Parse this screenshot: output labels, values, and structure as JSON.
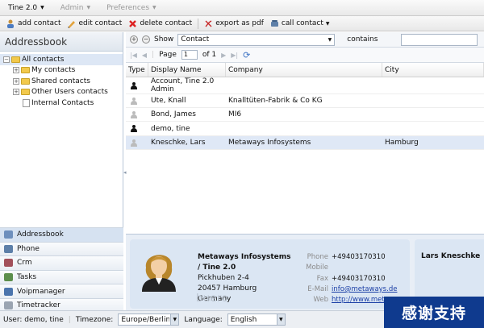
{
  "menubar": {
    "app": "Tine 2.0",
    "admin": "Admin",
    "preferences": "Preferences"
  },
  "toolbar": {
    "add": "add contact",
    "edit": "edit contact",
    "delete": "delete contact",
    "export": "export as pdf",
    "call": "call contact"
  },
  "left": {
    "title": "Addressbook",
    "tree": [
      "All contacts",
      "My contacts",
      "Shared contacts",
      "Other Users contacts",
      "Internal Contacts"
    ],
    "modules": [
      "Addressbook",
      "Phone",
      "Crm",
      "Tasks",
      "Voipmanager",
      "Timetracker"
    ]
  },
  "filter": {
    "show_label": "Show",
    "field": "Contact",
    "operator": "contains",
    "value": ""
  },
  "pager": {
    "page_label": "Page",
    "page": "1",
    "of_label": "of 1"
  },
  "grid": {
    "columns": [
      "Type",
      "Display Name",
      "Company",
      "City"
    ],
    "rows": [
      {
        "name": "Account, Tine 2.0 Admin",
        "company": "",
        "city": "",
        "type_color": "#111"
      },
      {
        "name": "Üte, Knall",
        "company": "Knalltüten-Fabrik & Co KG",
        "city": "",
        "type_color": "#bbb"
      },
      {
        "name": "Bond, James",
        "company": "MI6",
        "city": "",
        "type_color": "#bbb"
      },
      {
        "name": "demo, tine",
        "company": "",
        "city": "",
        "type_color": "#111"
      },
      {
        "name": "Kneschke, Lars",
        "company": "Metaways Infosystems",
        "city": "Hamburg",
        "type_color": "#bbb"
      }
    ]
  },
  "detail": {
    "org_line1": "Metaways Infosystems",
    "org_line2": "/ Tine 2.0",
    "street": "Pickhuben 2-4",
    "city": "20457 Hamburg",
    "country": "Germany",
    "watermark": "buero",
    "labels": [
      "Phone",
      "Mobile",
      "Fax",
      "E-Mail",
      "Web"
    ],
    "phone": "+49403170310",
    "mobile": "",
    "fax": "+49403170310",
    "email": "info@metaways.de",
    "web": "http://www.meta...",
    "contact_name": "Lars Kneschke"
  },
  "status": {
    "user_label": "User: demo, tine",
    "tz_label": "Timezone:",
    "tz": "Europe/Berlin",
    "lang_label": "Language:",
    "lang": "English"
  },
  "badge": "感谢支持"
}
